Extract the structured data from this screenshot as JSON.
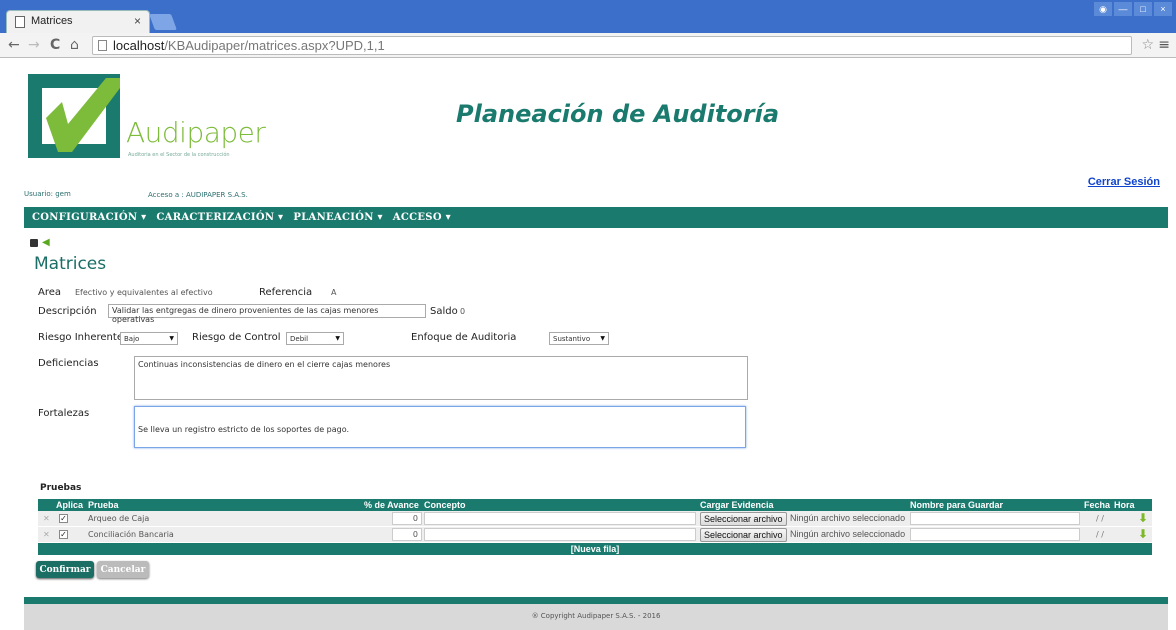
{
  "browser": {
    "tab_title": "Matrices",
    "tab_close": "×",
    "url_host": "localhost",
    "url_path": "/KBAudipaper/matrices.aspx?UPD,1,1"
  },
  "header": {
    "logo_text": "Audipaper",
    "logo_tagline": "Auditoria en el Sector de la construcción",
    "title": "Planeación de Auditoría",
    "user_label": "Usuario:",
    "user_value": "gem",
    "access_label": "Acceso a :",
    "access_value": "AUDIPAPER S.A.S.",
    "logout": "Cerrar Sesión"
  },
  "nav": {
    "items": [
      "CONFIGURACIÓN ▾",
      "CARACTERIZACIÓN ▾",
      "PLANEACIÓN ▾",
      "ACCESO ▾"
    ]
  },
  "form": {
    "section_title": "Matrices",
    "area_label": "Area",
    "area_value": "Efectivo y equivalentes al efectivo",
    "referencia_label": "Referencia",
    "referencia_value": "A",
    "descripcion_label": "Descripción",
    "descripcion_value": "Validar las entgregas de dinero provenientes de las cajas menores operativas",
    "saldo_label": "Saldo",
    "saldo_value": "0",
    "riesgo_inherente_label": "Riesgo Inherente",
    "riesgo_inherente_value": "Bajo",
    "riesgo_control_label": "Riesgo de Control",
    "riesgo_control_value": "Debil",
    "enfoque_label": "Enfoque de Auditoria",
    "enfoque_value": "Sustantivo",
    "deficiencias_label": "Deficiencias",
    "deficiencias_value": "Continuas inconsistencias de dinero en el cierre cajas menores",
    "fortalezas_label": "Fortalezas",
    "fortalezas_value": "Se lleva un registro estricto de los soportes de pago."
  },
  "pruebas": {
    "label": "Pruebas",
    "columns": [
      "Aplica",
      "Prueba",
      "% de Avance",
      "Concepto",
      "Cargar Evidencia",
      "Nombre para Guardar",
      "Fecha",
      "Hora"
    ],
    "rows": [
      {
        "prueba": "Arqueo de Caja",
        "avance": "0",
        "file_button": "Seleccionar archivo",
        "file_status": "Ningún archivo seleccionado",
        "fecha": "/ /"
      },
      {
        "prueba": "Conciliación Bancaria",
        "avance": "0",
        "file_button": "Seleccionar archivo",
        "file_status": "Ningún archivo seleccionado",
        "fecha": "/ /"
      }
    ],
    "new_row": "[Nueva fila]"
  },
  "buttons": {
    "confirm": "Confirmar",
    "cancel": "Cancelar"
  },
  "footer": {
    "copyright": "® Copyright Audipaper S.A.S. - 2016"
  },
  "colors": {
    "primary": "#1b7a6e",
    "logo_green": "#7dbb3a",
    "link": "#1144cc"
  }
}
